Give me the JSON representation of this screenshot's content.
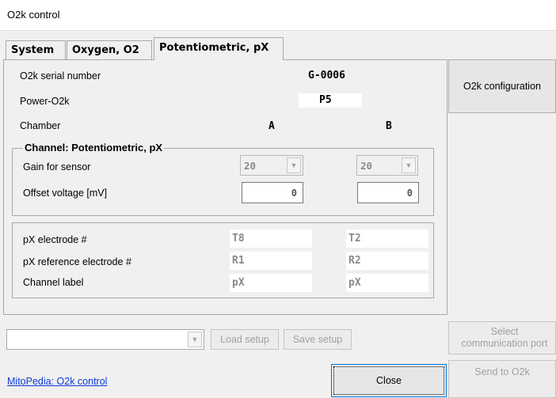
{
  "window": {
    "title": "O2k control"
  },
  "tabs": [
    {
      "label": "System"
    },
    {
      "label": "Oxygen, O2"
    },
    {
      "label": "Potentiometric, pX"
    }
  ],
  "panel": {
    "serial_label": "O2k serial number",
    "serial_value": "G-0006",
    "power_label": "Power-O2k",
    "power_value": "P5",
    "chamber_label": "Chamber",
    "chamber_a": "A",
    "chamber_b": "B",
    "channel_group": {
      "title": "Channel: Potentiometric, pX",
      "gain_label": "Gain for sensor",
      "gain_a": "20",
      "gain_b": "20",
      "offset_label": "Offset voltage [mV]",
      "offset_a": "0",
      "offset_b": "0"
    },
    "electrode_group": {
      "px_label": "pX electrode #",
      "px_a": "T8",
      "px_b": "T2",
      "ref_label": "pX reference electrode #",
      "ref_a": "R1",
      "ref_b": "R2",
      "channel_label_label": "Channel label",
      "channel_label_a": "pX",
      "channel_label_b": "pX"
    }
  },
  "right_buttons": {
    "config": "O2k configuration",
    "select_port": "Select communication port",
    "send": "Send to O2k"
  },
  "footer": {
    "setup_select_value": "",
    "load_setup": "Load setup",
    "save_setup": "Save setup",
    "close": "Close",
    "link": "MitoPedia: O2k control"
  },
  "colors": {
    "window_bg": "#f0f0f0",
    "link": "#0b3ad8",
    "disabled_text": "#a0a0a0"
  }
}
